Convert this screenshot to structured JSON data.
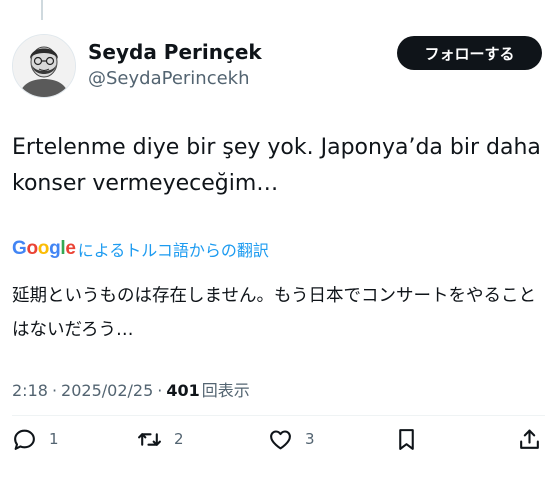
{
  "author": {
    "display_name": "Seyda Perinçek",
    "handle": "@SeydaPerincekh"
  },
  "follow_button": {
    "label": "フォローする"
  },
  "tweet": {
    "text": "Ertelenme diye bir şey yok. Japonya’da bir daha konser vermeyeceğim…"
  },
  "translation": {
    "provider_logo": "Google",
    "label": "によるトルコ語からの翻訳",
    "text": "延期というものは存在しません。もう日本でコンサートをやることはないだろう…"
  },
  "meta": {
    "time": "2:18",
    "separator": "·",
    "date": "2025/02/25",
    "views_count": "401",
    "views_label": "回表示"
  },
  "actions": {
    "reply": {
      "icon": "reply-icon",
      "count": "1"
    },
    "retweet": {
      "icon": "retweet-icon",
      "count": "2"
    },
    "like": {
      "icon": "heart-icon",
      "count": "3"
    },
    "bookmark": {
      "icon": "bookmark-icon"
    },
    "share": {
      "icon": "share-icon"
    }
  },
  "colors": {
    "text": "#0f1419",
    "secondary": "#536471",
    "link": "#1d9bf0",
    "button_bg": "#0f1419"
  }
}
